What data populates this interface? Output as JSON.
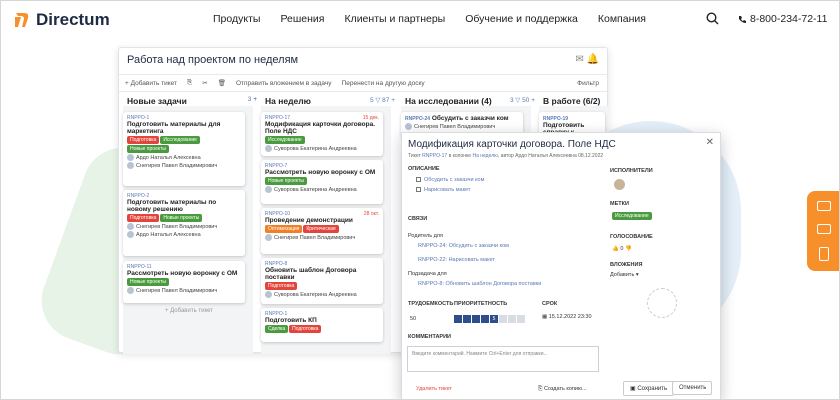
{
  "nav": {
    "brand": "Directum",
    "links": [
      "Продукты",
      "Решения",
      "Клиенты и партнеры",
      "Обучение и поддержка",
      "Компания"
    ],
    "phone": "8-800-234-72-11"
  },
  "app": {
    "title": "Работа над проектом по неделям",
    "toolbar": [
      "+ Добавить тикет",
      "Отправить вложением в задачу",
      "Перенести на другую доску",
      "Фильтр"
    ],
    "columns": [
      {
        "name": "Новые задачи",
        "count": "3",
        "meta": "+"
      },
      {
        "name": "На неделю",
        "count": "",
        "meta": "5 ▽ 87 +"
      },
      {
        "name": "На исследовании (4)",
        "count": "",
        "meta": "3 ▽ 50 +"
      },
      {
        "name": "В работе (6/2)",
        "count": "",
        "meta": ""
      }
    ],
    "cards_col1": [
      {
        "id": "RNPPO-1",
        "title": "Подготовить материалы для маркетинга",
        "tags": [
          [
            "Подготовка",
            "red"
          ],
          [
            "Исследование",
            "green"
          ],
          [
            "Новые проекты",
            "green"
          ]
        ],
        "people": [
          "Ардо Наталья Алексевна",
          "Снегирев Павел Владимирович"
        ]
      },
      {
        "id": "RNPPO-2",
        "title": "Подготовить материалы по новому решению",
        "tags": [
          [
            "Подготовка",
            "red"
          ],
          [
            "Новые проекты",
            "green"
          ]
        ],
        "people": [
          "Снегирев Павел Владимирович",
          "Ардо Наталья Алексевна"
        ]
      },
      {
        "id": "RNPPO-11",
        "title": "Рассмотреть новую воронку с ОМ",
        "tags": [
          [
            "Новые проекты",
            "green"
          ]
        ],
        "people": [
          "Снегирев Павел Владимирович"
        ]
      }
    ],
    "cards_col2": [
      {
        "id": "RNPPO-17",
        "title": "Модификация карточки договора. Поле НДС",
        "date": "15 дек.",
        "tags": [
          [
            "Исследование",
            "green"
          ]
        ],
        "people": [
          "Суворова Екатерина Андреевна"
        ]
      },
      {
        "id": "RNPPO-7",
        "title": "Рассмотреть новую воронку с ОМ",
        "tags": [
          [
            "Новые проекты",
            "green"
          ]
        ],
        "people": [
          "Суворова Екатерина Андреевна"
        ]
      },
      {
        "id": "RNPPO-10",
        "title": "Проведение демонстрации",
        "date": "28 окт.",
        "tags": [
          [
            "Оптимизация",
            "orange"
          ],
          [
            "Критическая",
            "red"
          ]
        ],
        "people": [
          "Снегирев Павел Владимирович"
        ]
      },
      {
        "id": "RNPPO-8",
        "title": "Обновить шаблон Договора поставки",
        "tags": [
          [
            "Подготовка",
            "red"
          ]
        ],
        "people": [
          "Суворова Екатерина Андреевна"
        ]
      },
      {
        "id": "RNPPO-1",
        "title": "Подготовить КП",
        "tags": [
          [
            "Сделка",
            "green"
          ],
          [
            "Подготовка",
            "red"
          ]
        ],
        "people": []
      }
    ],
    "cards_col3": [
      {
        "id": "RNPPO-24",
        "title": "Обсудить с заказчи ком",
        "people": [
          "Снегирев Павел Владимирович"
        ]
      }
    ],
    "cards_col4": [
      {
        "id": "RNPPO-19",
        "title": "Подготовить справку к личному делу"
      }
    ],
    "add_task": "Добавить тикет"
  },
  "dialog": {
    "title": "Модификация карточки договора. Поле НДС",
    "sub_prefix": "Тикет",
    "ticket": "RNPPO-17",
    "sub_mid": "в колонке",
    "column": "На неделю",
    "sub_tail": ", автор Ардо Наталья Алексеевна 08.12.2022",
    "labels": {
      "description": "ОПИСАНИЕ",
      "links": "СВЯЗИ",
      "parent": "Родитель для",
      "child": "Подзадача для",
      "effort": "ТРУДОЕМКОСТЬ",
      "priority": "ПРИОРИТЕТНОСТЬ",
      "deadline": "СРОК",
      "comments": "КОММЕНТАРИИ",
      "executors": "ИСПОЛНИТЕЛИ",
      "tags": "МЕТКИ",
      "vote": "ГОЛОСОВАНИЕ",
      "attachments": "ВЛОЖЕНИЯ"
    },
    "checklist": [
      "Обсудить с заказчи ком",
      "Нарисовать макет"
    ],
    "parent_links": [
      "RNPPO-24: Обсудить с заказчи ком",
      "RNPPO-22: Нарисовать макет"
    ],
    "child_link": "RNPPO-8: Обновить шаблон Договора поставки",
    "effort_value": "50",
    "priority_level": 5,
    "deadline_value": "15.12.2022 23:30",
    "comment_placeholder": "Введите комментарий. Нажмите Ctrl+Enter для отправки...",
    "tag": "Исследование",
    "vote_count": "0",
    "add_attachment": "Добавить",
    "delete": "Удалить тикет",
    "create_copy": "Создать копию...",
    "save": "Сохранить",
    "cancel": "Отменить"
  },
  "colors": {
    "brand_orange": "#f7902a",
    "accent_blue": "#2d4e8a"
  }
}
